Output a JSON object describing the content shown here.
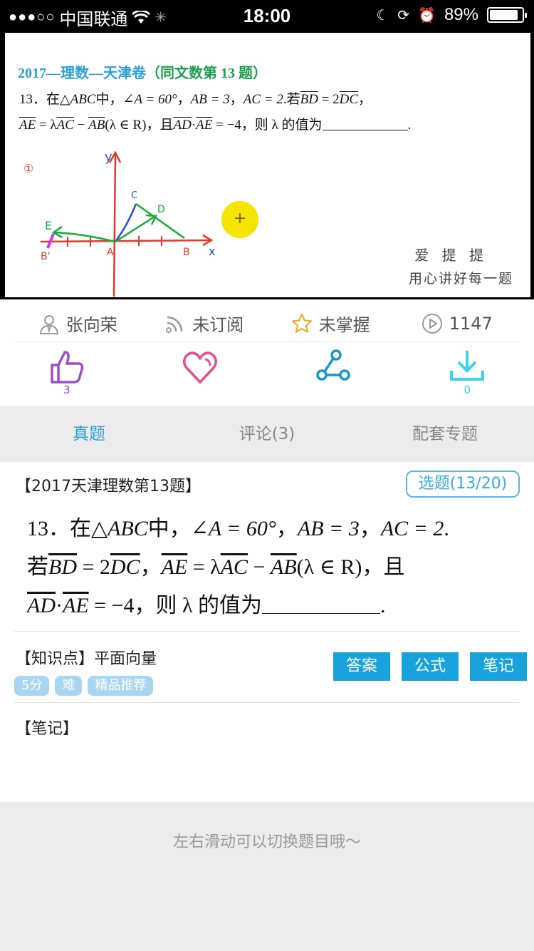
{
  "status_bar": {
    "signal_dots": "●●●○○",
    "carrier": "中国联通",
    "time": "18:00",
    "battery_text": "89%",
    "battery_level": 0.89
  },
  "video": {
    "title_a": "2017—理数—天津卷",
    "title_b": "（同文数第 13 题）",
    "line1": {
      "p1": "13．在",
      "tri": "△ABC",
      "p2": "中，",
      "angle": "∠A = 60°",
      "p3": "，",
      "ab": "AB = 3",
      "p4": "，",
      "ac": "AC = 2",
      "p5": ".若",
      "bd": "BD",
      "p6": " = 2",
      "dc": "DC",
      "p7": "，"
    },
    "line2": {
      "ae": "AE",
      "p1": " = λ",
      "ac": "AC",
      "p2": " − ",
      "ab": "AB",
      "p3": "(λ ∈ R)，且",
      "ad": "AD",
      "p4": "·",
      "ae2": "AE",
      "p5": " = −4，则 λ 的值为",
      "p6": "."
    },
    "diagram_labels": {
      "y": "y",
      "x": "x",
      "a": "A",
      "b": "B",
      "c": "C",
      "d": "D",
      "e": "E",
      "b_prime": "B'",
      "step": "①"
    },
    "watermark_line1": "爱 提 提",
    "watermark_line2": "用心讲好每一题"
  },
  "info": {
    "author": "张向荣",
    "subscribe": "未订阅",
    "mastery": "未掌握",
    "plays": "1147"
  },
  "actions": {
    "like_count": "3",
    "download_count": "0"
  },
  "tabs": [
    "真题",
    "评论(3)",
    "配套专题"
  ],
  "question": {
    "header": "【2017天津理数第13题】",
    "select_button": "选题(13/20)",
    "l1": {
      "p1": "13．在",
      "tri": "△ABC",
      "p2": "中，",
      "angle": "∠A = 60°",
      "p3": "，",
      "ab": "AB = 3",
      "p4": "，",
      "ac": "AC = 2",
      "p5": "."
    },
    "l2": {
      "p1": "若",
      "bd": "BD",
      "p2": " = 2",
      "dc": "DC",
      "p3": "，",
      "ae": "AE",
      "p4": " = λ",
      "ac": "AC",
      "p5": " − ",
      "ab": "AB",
      "p6": "(λ ∈ R)，且"
    },
    "l3": {
      "ad": "AD",
      "p1": "·",
      "ae": "AE",
      "p2": " = −4，则 λ 的值为",
      "p3": "."
    }
  },
  "knowledge": {
    "label": "【知识点】平面向量",
    "tags": [
      "5分",
      "难",
      "精品推荐"
    ],
    "buttons": [
      "答案",
      "公式",
      "笔记"
    ]
  },
  "notes_label": "【笔记】",
  "footer_hint": "左右滑动可以切换题目哦～",
  "colors": {
    "accent": "#19a3dc",
    "like_purple": "#9b4fc8",
    "heart_pink": "#e5508e",
    "download_cyan": "#3dd3e8",
    "star_orange": "#f4a623"
  }
}
